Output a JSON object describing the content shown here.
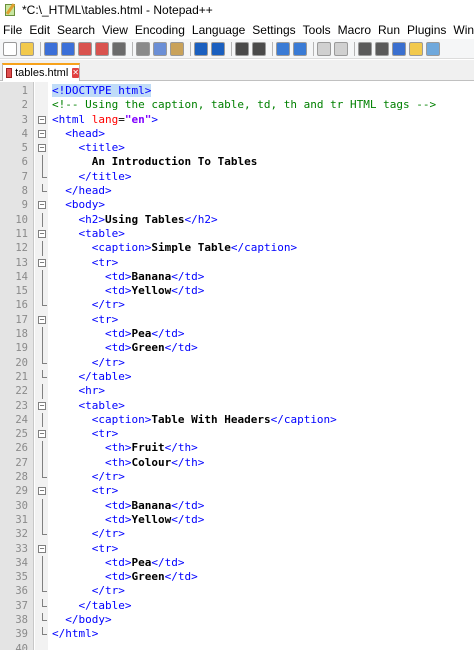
{
  "window": {
    "title": "*C:\\_HTML\\tables.html - Notepad++"
  },
  "menu": [
    "File",
    "Edit",
    "Search",
    "View",
    "Encoding",
    "Language",
    "Settings",
    "Tools",
    "Macro",
    "Run",
    "Plugins",
    "Window"
  ],
  "toolbar": {
    "buttons": [
      "new-file",
      "open-file",
      "save",
      "save-all",
      "close",
      "close-all",
      "print",
      "cut",
      "copy",
      "paste",
      "undo",
      "redo",
      "find",
      "replace",
      "zoom-in",
      "zoom-out",
      "sync-vertical",
      "sync-horizontal",
      "word-wrap",
      "show-all-chars",
      "indent-guide",
      "user-lang",
      "doc-map"
    ]
  },
  "tab": {
    "label": "tables.html",
    "close": "✕"
  },
  "editor": {
    "lines": [
      {
        "n": "1",
        "fold": "none",
        "parts": [
          [
            "doc",
            "<!DOCTYPE html>"
          ]
        ]
      },
      {
        "n": "2",
        "fold": "none",
        "parts": [
          [
            "com",
            "<!-- Using the caption, table, td, th and tr HTML tags -->"
          ]
        ]
      },
      {
        "n": "3",
        "fold": "open",
        "parts": [
          [
            "tag",
            "<html "
          ],
          [
            "attr",
            "lang"
          ],
          [
            "eq",
            "="
          ],
          [
            "val",
            "\"en\""
          ],
          [
            "tag",
            ">"
          ]
        ]
      },
      {
        "n": "4",
        "fold": "open",
        "parts": [
          [
            "plain",
            "  "
          ],
          [
            "tag",
            "<head>"
          ]
        ]
      },
      {
        "n": "5",
        "fold": "open",
        "parts": [
          [
            "plain",
            "    "
          ],
          [
            "tag",
            "<title>"
          ]
        ]
      },
      {
        "n": "6",
        "fold": "line",
        "parts": [
          [
            "plain",
            "      "
          ],
          [
            "txt",
            "An Introduction To Tables"
          ]
        ]
      },
      {
        "n": "7",
        "fold": "end",
        "parts": [
          [
            "plain",
            "    "
          ],
          [
            "tag",
            "</title>"
          ]
        ]
      },
      {
        "n": "8",
        "fold": "end",
        "parts": [
          [
            "plain",
            "  "
          ],
          [
            "tag",
            "</head>"
          ]
        ]
      },
      {
        "n": "9",
        "fold": "open",
        "parts": [
          [
            "plain",
            "  "
          ],
          [
            "tag",
            "<body>"
          ]
        ]
      },
      {
        "n": "10",
        "fold": "line",
        "parts": [
          [
            "plain",
            "    "
          ],
          [
            "tag",
            "<h2>"
          ],
          [
            "txt",
            "Using Tables"
          ],
          [
            "tag",
            "</h2>"
          ]
        ]
      },
      {
        "n": "11",
        "fold": "open",
        "parts": [
          [
            "plain",
            "    "
          ],
          [
            "tag",
            "<table>"
          ]
        ]
      },
      {
        "n": "12",
        "fold": "line",
        "parts": [
          [
            "plain",
            "      "
          ],
          [
            "tag",
            "<caption>"
          ],
          [
            "txt",
            "Simple Table"
          ],
          [
            "tag",
            "</caption>"
          ]
        ]
      },
      {
        "n": "13",
        "fold": "open",
        "parts": [
          [
            "plain",
            "      "
          ],
          [
            "tag",
            "<tr>"
          ]
        ]
      },
      {
        "n": "14",
        "fold": "line",
        "parts": [
          [
            "plain",
            "        "
          ],
          [
            "tag",
            "<td>"
          ],
          [
            "txt",
            "Banana"
          ],
          [
            "tag",
            "</td>"
          ]
        ]
      },
      {
        "n": "15",
        "fold": "line",
        "parts": [
          [
            "plain",
            "        "
          ],
          [
            "tag",
            "<td>"
          ],
          [
            "txt",
            "Yellow"
          ],
          [
            "tag",
            "</td>"
          ]
        ]
      },
      {
        "n": "16",
        "fold": "end",
        "parts": [
          [
            "plain",
            "      "
          ],
          [
            "tag",
            "</tr>"
          ]
        ]
      },
      {
        "n": "17",
        "fold": "open",
        "parts": [
          [
            "plain",
            "      "
          ],
          [
            "tag",
            "<tr>"
          ]
        ]
      },
      {
        "n": "18",
        "fold": "line",
        "parts": [
          [
            "plain",
            "        "
          ],
          [
            "tag",
            "<td>"
          ],
          [
            "txt",
            "Pea"
          ],
          [
            "tag",
            "</td>"
          ]
        ]
      },
      {
        "n": "19",
        "fold": "line",
        "parts": [
          [
            "plain",
            "        "
          ],
          [
            "tag",
            "<td>"
          ],
          [
            "txt",
            "Green"
          ],
          [
            "tag",
            "</td>"
          ]
        ]
      },
      {
        "n": "20",
        "fold": "end",
        "parts": [
          [
            "plain",
            "      "
          ],
          [
            "tag",
            "</tr>"
          ]
        ]
      },
      {
        "n": "21",
        "fold": "end",
        "parts": [
          [
            "plain",
            "    "
          ],
          [
            "tag",
            "</table>"
          ]
        ]
      },
      {
        "n": "22",
        "fold": "line",
        "parts": [
          [
            "plain",
            "    "
          ],
          [
            "tag",
            "<hr>"
          ]
        ]
      },
      {
        "n": "23",
        "fold": "open",
        "parts": [
          [
            "plain",
            "    "
          ],
          [
            "tag",
            "<table>"
          ]
        ]
      },
      {
        "n": "24",
        "fold": "line",
        "parts": [
          [
            "plain",
            "      "
          ],
          [
            "tag",
            "<caption>"
          ],
          [
            "txt",
            "Table With Headers"
          ],
          [
            "tag",
            "</caption>"
          ]
        ]
      },
      {
        "n": "25",
        "fold": "open",
        "parts": [
          [
            "plain",
            "      "
          ],
          [
            "tag",
            "<tr>"
          ]
        ]
      },
      {
        "n": "26",
        "fold": "line",
        "parts": [
          [
            "plain",
            "        "
          ],
          [
            "tag",
            "<th>"
          ],
          [
            "txt",
            "Fruit"
          ],
          [
            "tag",
            "</th>"
          ]
        ]
      },
      {
        "n": "27",
        "fold": "line",
        "parts": [
          [
            "plain",
            "        "
          ],
          [
            "tag",
            "<th>"
          ],
          [
            "txt",
            "Colour"
          ],
          [
            "tag",
            "</th>"
          ]
        ]
      },
      {
        "n": "28",
        "fold": "end",
        "parts": [
          [
            "plain",
            "      "
          ],
          [
            "tag",
            "</tr>"
          ]
        ]
      },
      {
        "n": "29",
        "fold": "open",
        "parts": [
          [
            "plain",
            "      "
          ],
          [
            "tag",
            "<tr>"
          ]
        ]
      },
      {
        "n": "30",
        "fold": "line",
        "parts": [
          [
            "plain",
            "        "
          ],
          [
            "tag",
            "<td>"
          ],
          [
            "txt",
            "Banana"
          ],
          [
            "tag",
            "</td>"
          ]
        ]
      },
      {
        "n": "31",
        "fold": "line",
        "parts": [
          [
            "plain",
            "        "
          ],
          [
            "tag",
            "<td>"
          ],
          [
            "txt",
            "Yellow"
          ],
          [
            "tag",
            "</td>"
          ]
        ]
      },
      {
        "n": "32",
        "fold": "end",
        "parts": [
          [
            "plain",
            "      "
          ],
          [
            "tag",
            "</tr>"
          ]
        ]
      },
      {
        "n": "33",
        "fold": "open",
        "parts": [
          [
            "plain",
            "      "
          ],
          [
            "tag",
            "<tr>"
          ]
        ]
      },
      {
        "n": "34",
        "fold": "line",
        "parts": [
          [
            "plain",
            "        "
          ],
          [
            "tag",
            "<td>"
          ],
          [
            "txt",
            "Pea"
          ],
          [
            "tag",
            "</td>"
          ]
        ]
      },
      {
        "n": "35",
        "fold": "line",
        "parts": [
          [
            "plain",
            "        "
          ],
          [
            "tag",
            "<td>"
          ],
          [
            "txt",
            "Green"
          ],
          [
            "tag",
            "</td>"
          ]
        ]
      },
      {
        "n": "36",
        "fold": "end",
        "parts": [
          [
            "plain",
            "      "
          ],
          [
            "tag",
            "</tr>"
          ]
        ]
      },
      {
        "n": "37",
        "fold": "end",
        "parts": [
          [
            "plain",
            "    "
          ],
          [
            "tag",
            "</table>"
          ]
        ]
      },
      {
        "n": "38",
        "fold": "end",
        "parts": [
          [
            "plain",
            "  "
          ],
          [
            "tag",
            "</body>"
          ]
        ]
      },
      {
        "n": "39",
        "fold": "end",
        "parts": [
          [
            "tag",
            "</html>"
          ]
        ]
      },
      {
        "n": "40",
        "fold": "none",
        "parts": []
      }
    ]
  },
  "colors": {
    "tag": "#0000ff",
    "text": "#000000",
    "comment": "#008000",
    "attribute": "#ff0000",
    "value": "#8000ff",
    "tab_accent": "#f7a21b"
  }
}
